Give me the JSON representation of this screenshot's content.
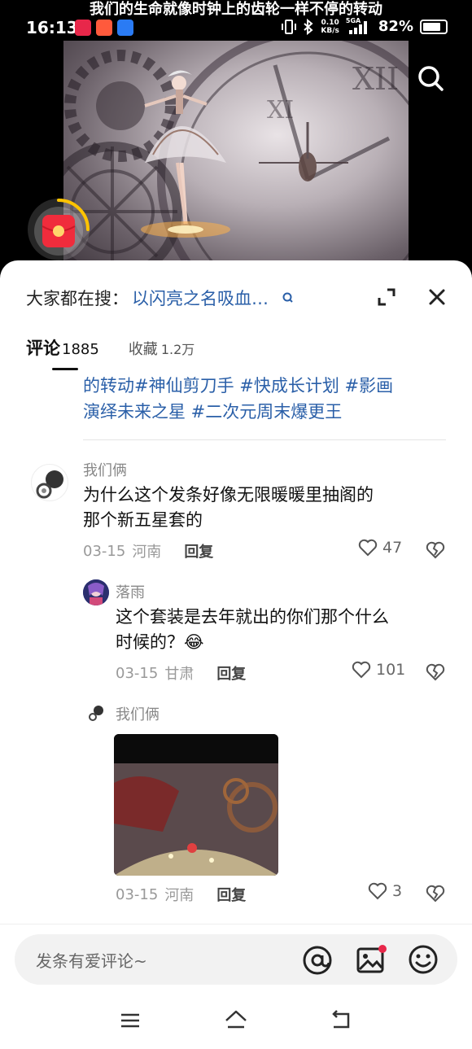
{
  "video": {
    "caption": "我们的生命就像时钟上的齿轮一样不停的转动"
  },
  "status_bar": {
    "time": "16:13",
    "net_speed_value": "0.10",
    "net_speed_unit": "KB/s",
    "network": "5GA",
    "battery_text": "82%",
    "battery_level": 0.82
  },
  "search_suggest": {
    "prefix": "大家都在搜：",
    "query": "以闪亮之名吸血…"
  },
  "tabs": [
    {
      "label": "评论",
      "count": "1885"
    },
    {
      "label": "收藏",
      "count": "1.2万"
    }
  ],
  "description": {
    "line1_plain": "的转动",
    "line1_tags": "#神仙剪刀手 #快成长计划 #影画",
    "line2_tags": "演绎未来之星 #二次元周末爆更王"
  },
  "comments": [
    {
      "user": "我们俩",
      "text_line1": "为什么这个发条好像无限暖暖里抽阁的",
      "text_line2": "那个新五星套的",
      "date": "03-15",
      "location": "河南",
      "reply_label": "回复",
      "likes": "47"
    },
    {
      "user": "落雨",
      "text_line1": "这个套装是去年就出的你们那个什么",
      "text_line2": "时候的？😂",
      "date": "03-15",
      "location": "甘肃",
      "reply_label": "回复",
      "likes": "101"
    },
    {
      "user": "我们俩",
      "date": "03-15",
      "location": "河南",
      "reply_label": "回复",
      "likes": "3"
    }
  ],
  "input": {
    "placeholder": "发条有爱评论~"
  },
  "colors": {
    "link_blue": "#2a5fa8",
    "accent_red": "#e8274a",
    "sheet_bg": "#ffffff"
  }
}
